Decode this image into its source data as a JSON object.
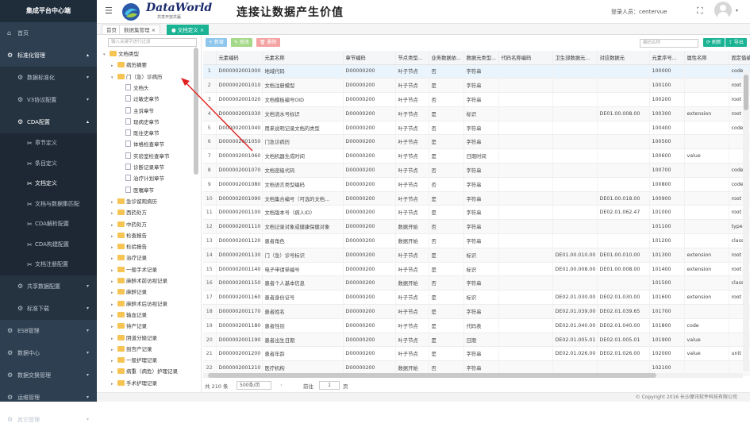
{
  "sidebar": {
    "title": "集成平台中心端",
    "items": [
      {
        "label": "首页"
      },
      {
        "label": "标准化管理"
      },
      {
        "label": "数据标准化"
      },
      {
        "label": "V3协议配置"
      },
      {
        "label": "CDA配置"
      },
      {
        "label": "章节定义"
      },
      {
        "label": "条目定义"
      },
      {
        "label": "文档定义"
      },
      {
        "label": "文档与数据集匹配"
      },
      {
        "label": "CDA解析配置"
      },
      {
        "label": "CDA构建配置"
      },
      {
        "label": "文档注册配置"
      },
      {
        "label": "共享数据配置"
      },
      {
        "label": "标准下载"
      },
      {
        "label": "ESB管理"
      },
      {
        "label": "数据中心"
      },
      {
        "label": "数据交换管理"
      },
      {
        "label": "运维管理"
      },
      {
        "label": "其它管理"
      }
    ]
  },
  "header": {
    "logo_text": "DataWorld",
    "logo_sub": "共享开放共赢",
    "slogan": "连接让数据产生价值",
    "user": "登录人员：centervue"
  },
  "tabs": [
    {
      "label": "首页"
    },
    {
      "label": "数据集管理 ×"
    },
    {
      "label": "● 文档定义 ×"
    }
  ],
  "tree": {
    "search_placeholder": "输入关键字进行过滤",
    "nodes": [
      {
        "label": "文档类型",
        "level": 0,
        "kind": "folder",
        "arrow": "▾"
      },
      {
        "label": "病历摘要",
        "level": 1,
        "kind": "folder",
        "arrow": "▸"
      },
      {
        "label": "门（急）诊病历",
        "level": 1,
        "kind": "folder",
        "arrow": "▾"
      },
      {
        "label": "文档头",
        "level": 2,
        "kind": "file",
        "arrow": ""
      },
      {
        "label": "过敏史章节",
        "level": 2,
        "kind": "file",
        "arrow": ""
      },
      {
        "label": "主诉章节",
        "level": 2,
        "kind": "file",
        "arrow": ""
      },
      {
        "label": "现病史章节",
        "level": 2,
        "kind": "file",
        "arrow": ""
      },
      {
        "label": "既往史章节",
        "level": 2,
        "kind": "file",
        "arrow": ""
      },
      {
        "label": "体格检查章节",
        "level": 2,
        "kind": "file",
        "arrow": ""
      },
      {
        "label": "实验室检查章节",
        "level": 2,
        "kind": "file",
        "arrow": ""
      },
      {
        "label": "诊断记录章节",
        "level": 2,
        "kind": "file",
        "arrow": ""
      },
      {
        "label": "治疗计划章节",
        "level": 2,
        "kind": "file",
        "arrow": ""
      },
      {
        "label": "医嘱章节",
        "level": 2,
        "kind": "file",
        "arrow": ""
      },
      {
        "label": "急诊留观病历",
        "level": 1,
        "kind": "folder",
        "arrow": "▸"
      },
      {
        "label": "西药处方",
        "level": 1,
        "kind": "folder",
        "arrow": "▸"
      },
      {
        "label": "中药处方",
        "level": 1,
        "kind": "folder",
        "arrow": "▸"
      },
      {
        "label": "检查报告",
        "level": 1,
        "kind": "folder",
        "arrow": "▸"
      },
      {
        "label": "检验报告",
        "level": 1,
        "kind": "folder",
        "arrow": "▸"
      },
      {
        "label": "治疗记录",
        "level": 1,
        "kind": "folder",
        "arrow": "▸"
      },
      {
        "label": "一般手术记录",
        "level": 1,
        "kind": "folder",
        "arrow": "▸"
      },
      {
        "label": "麻醉术前访视记录",
        "level": 1,
        "kind": "folder",
        "arrow": "▸"
      },
      {
        "label": "麻醉记录",
        "level": 1,
        "kind": "folder",
        "arrow": "▸"
      },
      {
        "label": "麻醉术后访视记录",
        "level": 1,
        "kind": "folder",
        "arrow": "▸"
      },
      {
        "label": "输血记录",
        "level": 1,
        "kind": "folder",
        "arrow": "▸"
      },
      {
        "label": "待产记录",
        "level": 1,
        "kind": "folder",
        "arrow": "▸"
      },
      {
        "label": "阴道分娩记录",
        "level": 1,
        "kind": "folder",
        "arrow": "▸"
      },
      {
        "label": "剖宫产记录",
        "level": 1,
        "kind": "folder",
        "arrow": "▸"
      },
      {
        "label": "一般护理记录",
        "level": 1,
        "kind": "folder",
        "arrow": "▸"
      },
      {
        "label": "病重（病危）护理记录",
        "level": 1,
        "kind": "folder",
        "arrow": "▸"
      },
      {
        "label": "手术护理记录",
        "level": 1,
        "kind": "folder",
        "arrow": "▸"
      }
    ]
  },
  "toolbar": {
    "add": "+ 新增",
    "edit": "✎ 修改",
    "delete": "🗑 删除",
    "search_placeholder": "编码名称",
    "refresh": "⟳ 刷新",
    "export": "⇪ 导出"
  },
  "table": {
    "columns": [
      "",
      "元素编码",
      "元素名称",
      "章节编码",
      "节点类型...",
      "业务数据依...",
      "数据元类型...",
      "代码名称编码",
      "卫生部数据元...",
      "对应数据元",
      "元素序号...",
      "属性名称",
      "固定值编..."
    ],
    "rows": [
      [
        "1",
        "D000002001000",
        "地域代码",
        "D00000200",
        "叶子节点",
        "否",
        "字符串",
        "",
        "",
        "",
        "100000",
        "",
        "code"
      ],
      [
        "2",
        "D000002001010",
        "文档注册模型",
        "D00000200",
        "叶子节点",
        "是",
        "字符串",
        "",
        "",
        "",
        "100100",
        "",
        "root"
      ],
      [
        "3",
        "D000002001020",
        "文档模板编号OID",
        "D00000200",
        "叶子节点",
        "否",
        "字符串",
        "",
        "",
        "",
        "100200",
        "",
        "root"
      ],
      [
        "4",
        "D000002001030",
        "文档流水号标识",
        "D00000200",
        "叶子节点",
        "是",
        "标识",
        "",
        "",
        "DE01.00.008.00",
        "100300",
        "extension",
        "root"
      ],
      [
        "5",
        "D000002001040",
        "用来说明记录文档的类型",
        "D00000200",
        "叶子节点",
        "否",
        "字符串",
        "",
        "",
        "",
        "100400",
        "",
        "code"
      ],
      [
        "6",
        "D000002001050",
        "门急诊病历",
        "D00000200",
        "叶子节点",
        "是",
        "字符串",
        "",
        "",
        "",
        "100500",
        "",
        ""
      ],
      [
        "7",
        "D000002001060",
        "文档机器生成时间",
        "D00000200",
        "叶子节点",
        "是",
        "日期时间",
        "",
        "",
        "",
        "100600",
        "value",
        ""
      ],
      [
        "8",
        "D000002001070",
        "文档密级代码",
        "D00000200",
        "叶子节点",
        "否",
        "字符串",
        "",
        "",
        "",
        "100700",
        "",
        "code"
      ],
      [
        "9",
        "D000002001080",
        "文档语言类型编码",
        "D00000200",
        "叶子节点",
        "否",
        "字符串",
        "",
        "",
        "",
        "100800",
        "",
        "code"
      ],
      [
        "10",
        "D000002001090",
        "文档集合编号（可选的文档...",
        "D00000200",
        "叶子节点",
        "是",
        "字符串",
        "",
        "",
        "DE01.00.018.00",
        "100900",
        "",
        "root"
      ],
      [
        "11",
        "D000002001100",
        "文档版本号（病人ID）",
        "D00000200",
        "叶子节点",
        "是",
        "字符串",
        "",
        "",
        "DE02.01.062.47",
        "101000",
        "",
        "root"
      ],
      [
        "12",
        "D000002001110",
        "文档记录对象或健康保健对象",
        "D00000200",
        "数据开始",
        "否",
        "字符串",
        "",
        "",
        "",
        "101100",
        "",
        "type"
      ],
      [
        "13",
        "D000002001120",
        "患者角色",
        "D00000200",
        "数据开始",
        "否",
        "字符串",
        "",
        "",
        "",
        "101200",
        "",
        "class"
      ],
      [
        "14",
        "D000002001130",
        "门（急）诊号标识",
        "D00000200",
        "叶子节点",
        "是",
        "标识",
        "",
        "DE01.00.010.00",
        "DE01.00.010.00",
        "101300",
        "extension",
        "root"
      ],
      [
        "15",
        "D000002001140",
        "电子申请单编号",
        "D00000200",
        "叶子节点",
        "是",
        "标识",
        "",
        "DE01.00.008.00",
        "DE01.00.008.00",
        "101400",
        "extension",
        "root"
      ],
      [
        "16",
        "D000002001150",
        "患者个人基本信息",
        "D00000200",
        "数据开始",
        "否",
        "字符串",
        "",
        "",
        "",
        "101500",
        "",
        "class"
      ],
      [
        "17",
        "D000002001160",
        "患者身份证号",
        "D00000200",
        "叶子节点",
        "是",
        "标识",
        "",
        "DE02.01.030.00",
        "DE02.01.030.00",
        "101600",
        "extension",
        "root"
      ],
      [
        "18",
        "D000002001170",
        "患者姓名",
        "D00000200",
        "叶子节点",
        "是",
        "字符串",
        "",
        "DE02.01.039.00",
        "DE02.01.039.65",
        "101700",
        "",
        ""
      ],
      [
        "19",
        "D000002001180",
        "患者性别",
        "D00000200",
        "叶子节点",
        "是",
        "代码表",
        "",
        "DE02.01.040.00",
        "DE02.01.040.00",
        "101800",
        "code",
        ""
      ],
      [
        "20",
        "D000002001190",
        "患者出生日期",
        "D00000200",
        "叶子节点",
        "是",
        "日期",
        "",
        "DE02.01.005.01",
        "DE02.01.005.01",
        "101900",
        "value",
        ""
      ],
      [
        "21",
        "D000002001200",
        "患者年龄",
        "D00000200",
        "叶子节点",
        "是",
        "字符串",
        "",
        "DE02.01.026.00",
        "DE02.01.026.00",
        "102000",
        "value",
        "unit"
      ],
      [
        "22",
        "D000002001210",
        "医疗机构",
        "D00000200",
        "数据开始",
        "否",
        "字符串",
        "",
        "",
        "",
        "102100",
        "",
        ""
      ]
    ]
  },
  "pager": {
    "total": "共 210 条",
    "size": "500条/页",
    "goto": "前往",
    "page": "1",
    "page_unit": "页"
  },
  "footer": "© Copyright 2016 长沙摩讯软件科技有限公司",
  "colors": {
    "sidebar": "#2e3f51",
    "accent": "#1ab394",
    "add": "#8ec6ec",
    "edit": "#a5d98a",
    "delete": "#f4a3a3"
  }
}
